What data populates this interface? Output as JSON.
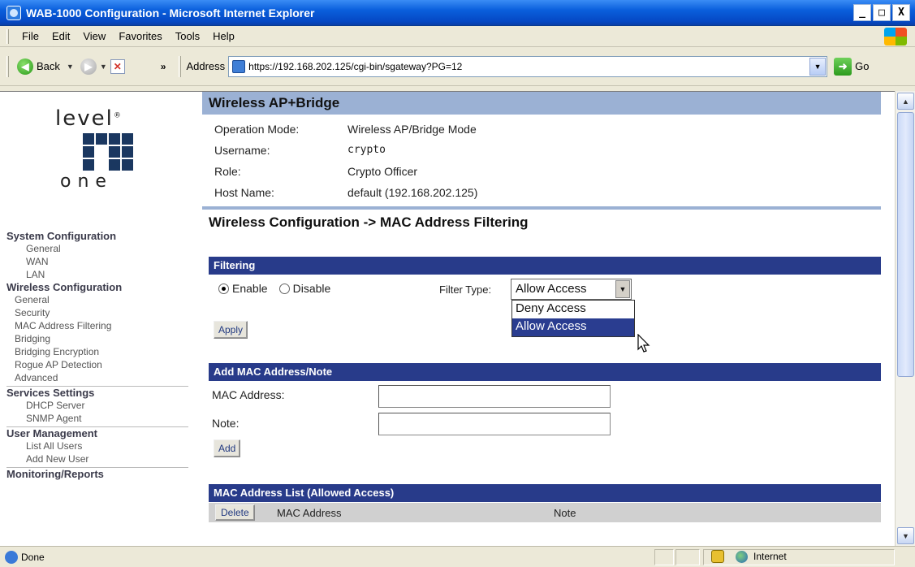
{
  "window": {
    "title": "WAB-1000 Configuration - Microsoft Internet Explorer",
    "buttons": [
      "_",
      "□",
      "X"
    ]
  },
  "menu": [
    "File",
    "Edit",
    "View",
    "Favorites",
    "Tools",
    "Help"
  ],
  "toolbar": {
    "back_label": "Back",
    "chevron": "»",
    "address_label": "Address",
    "url": "https://192.168.202.125/cgi-bin/sgateway?PG=12",
    "go_label": "Go"
  },
  "logo": {
    "top": "level",
    "mark": "®",
    "bottom": "one"
  },
  "sidebar": {
    "sections": [
      {
        "title": "System Configuration",
        "items": [
          "General",
          "WAN",
          "LAN"
        ]
      },
      {
        "title": "Wireless Configuration",
        "items": [
          "General",
          "Security",
          "MAC Address Filtering",
          "Bridging",
          "Bridging Encryption",
          "Rogue AP Detection",
          "Advanced"
        ]
      },
      {
        "title": "Services Settings",
        "items": [
          "DHCP Server",
          "SNMP Agent"
        ]
      },
      {
        "title": "User Management",
        "items": [
          "List All Users",
          "Add New User"
        ]
      },
      {
        "title": "Monitoring/Reports",
        "items": []
      }
    ]
  },
  "header": {
    "title": "Wireless AP+Bridge",
    "rows": [
      {
        "label": "Operation Mode:",
        "value": "Wireless AP/Bridge Mode"
      },
      {
        "label": "Username:",
        "value": "crypto"
      },
      {
        "label": "Role:",
        "value": "Crypto Officer"
      },
      {
        "label": "Host Name:",
        "value": "default (192.168.202.125)"
      }
    ]
  },
  "page": {
    "title": "Wireless Configuration -> MAC Address Filtering",
    "filtering": {
      "section": "Filtering",
      "enable_label": "Enable",
      "disable_label": "Disable",
      "selected": "enable",
      "filter_type_label": "Filter Type:",
      "filter_type_value": "Allow Access",
      "options": [
        "Deny Access",
        "Allow Access"
      ],
      "highlighted_option": "Allow Access",
      "apply_label": "Apply"
    },
    "add": {
      "section": "Add MAC Address/Note",
      "mac_label": "MAC Address:",
      "mac_value": "",
      "note_label": "Note:",
      "note_value": "",
      "add_label": "Add"
    },
    "list": {
      "section": "MAC Address List (Allowed Access)",
      "delete_label": "Delete",
      "columns": [
        "MAC Address",
        "Note"
      ]
    }
  },
  "status": {
    "text": "Done",
    "zone": "Internet"
  },
  "colors": {
    "header_bar": "#9bb1d4",
    "section_bar": "#283b8a",
    "selection": "#2a3d90"
  }
}
